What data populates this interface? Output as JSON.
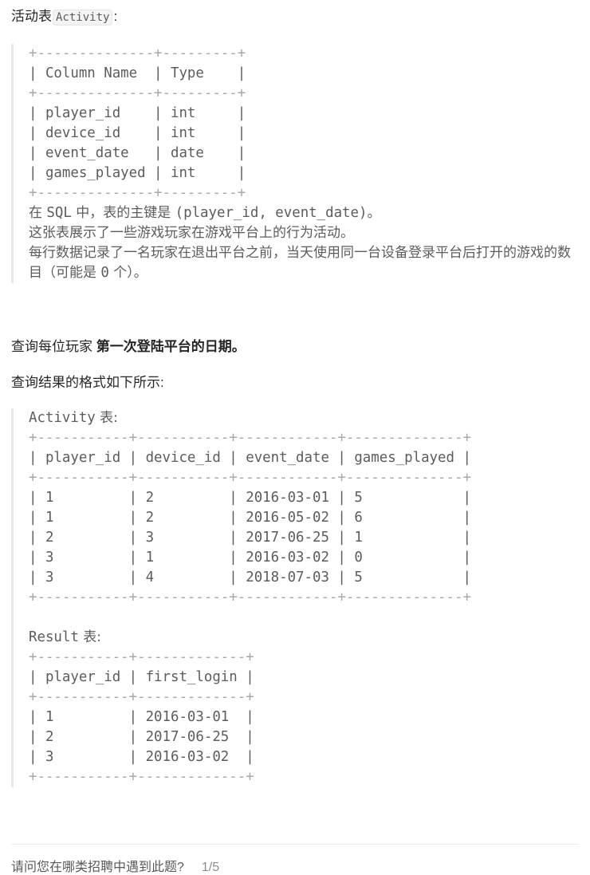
{
  "intro": {
    "prefix": "活动表",
    "table_name": "Activity",
    "suffix": ":"
  },
  "schema": {
    "border": "+--------------+---------+",
    "header": "| Column Name  | Type    |",
    "rows": [
      "| player_id    | int     |",
      "| device_id    | int     |",
      "| event_date   | date    |",
      "| games_played | int     |"
    ],
    "description": {
      "line1_a": "在 ",
      "line1_sql": "SQL",
      "line1_b": " 中，表的主键是 ",
      "line1_key": "(player_id, event_date)",
      "line1_c": "。",
      "line2": "这张表展示了一些游戏玩家在游戏平台上的行为活动。",
      "line3": "每行数据记录了一名玩家在退出平台之前，当天使用同一台设备登录平台后打开的游戏的数目（可能是 ",
      "line3_zero": "0",
      "line3_end": " 个）。"
    }
  },
  "task": {
    "prefix": "查询每位玩家 ",
    "bold": "第一次登陆平台的日期。"
  },
  "format_intro": "查询结果的格式如下所示:",
  "example": {
    "activity_label": "Activity",
    "activity_label_suffix": " 表:",
    "activity_border": "+-----------+-----------+------------+--------------+",
    "activity_header": "| player_id | device_id | event_date | games_played |",
    "activity_columns": [
      "player_id",
      "device_id",
      "event_date",
      "games_played"
    ],
    "activity_rows": [
      [
        "1",
        "2",
        "2016-03-01",
        "5"
      ],
      [
        "1",
        "2",
        "2016-05-02",
        "6"
      ],
      [
        "2",
        "3",
        "2017-06-25",
        "1"
      ],
      [
        "3",
        "1",
        "2016-03-02",
        "0"
      ],
      [
        "3",
        "4",
        "2018-07-03",
        "5"
      ]
    ],
    "activity_row_lines": [
      "| 1         | 2         | 2016-03-01 | 5            |",
      "| 1         | 2         | 2016-05-02 | 6            |",
      "| 2         | 3         | 2017-06-25 | 1            |",
      "| 3         | 1         | 2016-03-02 | 0            |",
      "| 3         | 4         | 2018-07-03 | 5            |"
    ],
    "result_label": "Result",
    "result_label_suffix": " 表:",
    "result_border": "+-----------+-------------+",
    "result_header": "| player_id | first_login |",
    "result_columns": [
      "player_id",
      "first_login"
    ],
    "result_rows": [
      [
        "1",
        "2016-03-01"
      ],
      [
        "2",
        "2017-06-25"
      ],
      [
        "3",
        "2016-03-02"
      ]
    ],
    "result_row_lines": [
      "| 1         | 2016-03-01  |",
      "| 2         | 2017-06-25  |",
      "| 3         | 2016-03-02  |"
    ]
  },
  "footer": {
    "question": "请问您在哪类招聘中遇到此题?",
    "counter": "1/5"
  }
}
